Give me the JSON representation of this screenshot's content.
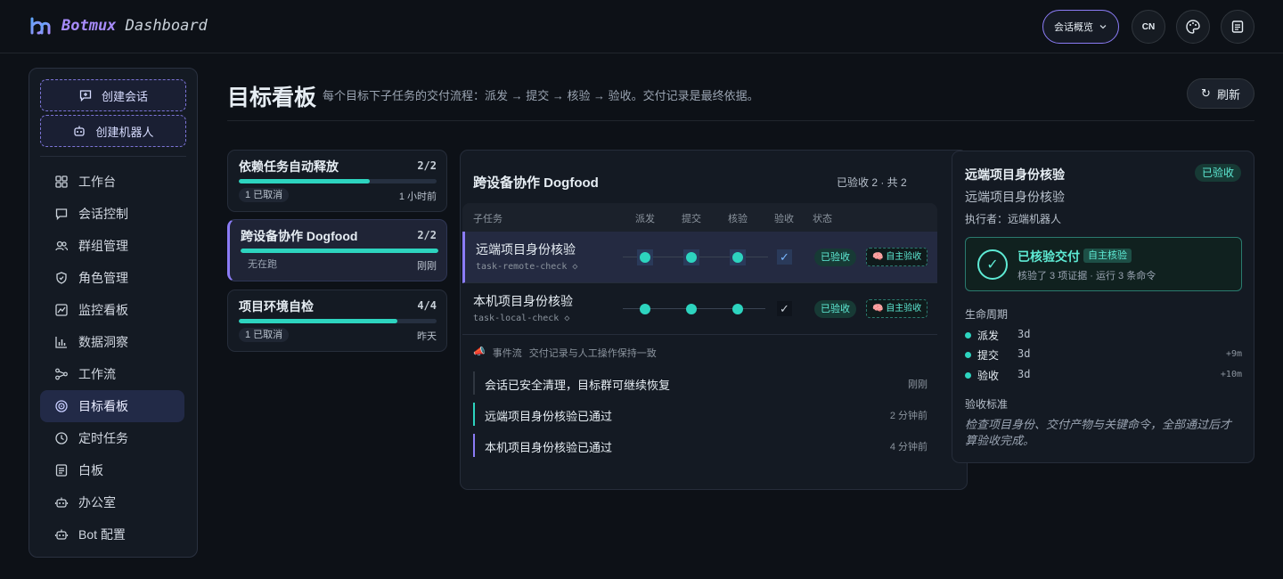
{
  "header": {
    "brand_a": "Botmux",
    "brand_b": "Dashboard",
    "view_select": "会话概览",
    "lang_button": "CN"
  },
  "sidebar": {
    "create_session": "创建会话",
    "create_bot": "创建机器人",
    "items": [
      {
        "label": "工作台",
        "icon": "grid-icon"
      },
      {
        "label": "会话控制",
        "icon": "chat-icon"
      },
      {
        "label": "群组管理",
        "icon": "users-icon"
      },
      {
        "label": "角色管理",
        "icon": "shield-icon"
      },
      {
        "label": "监控看板",
        "icon": "monitor-icon"
      },
      {
        "label": "数据洞察",
        "icon": "bar-chart-icon"
      },
      {
        "label": "工作流",
        "icon": "workflow-icon"
      },
      {
        "label": "目标看板",
        "icon": "target-icon",
        "active": true
      },
      {
        "label": "定时任务",
        "icon": "clock-icon"
      },
      {
        "label": "白板",
        "icon": "document-icon"
      },
      {
        "label": "办公室",
        "icon": "robot-icon"
      },
      {
        "label": "Bot 配置",
        "icon": "robot-icon"
      }
    ]
  },
  "main": {
    "title": "目标看板",
    "description": "每个目标下子任务的交付流程：派发 → 提交 → 核验 → 验收。交付记录是最终依据。",
    "refresh": "刷新"
  },
  "goals": [
    {
      "title": "依赖任务自动释放",
      "count": "2/2",
      "progress": 0.66,
      "left": "1 已取消",
      "right": "1 小时前"
    },
    {
      "title": "跨设备协作 Dogfood",
      "count": "2/2",
      "progress": 1.0,
      "left": "无在跑",
      "right": "刚刚",
      "active": true
    },
    {
      "title": "项目环境自检",
      "count": "4/4",
      "progress": 0.8,
      "left": "1 已取消",
      "right": "昨天"
    }
  ],
  "detail": {
    "title": "跨设备协作 Dogfood",
    "summary": "已验收 2 · 共 2",
    "columns": {
      "task": "子任务",
      "dispatch": "派发",
      "submit": "提交",
      "verify": "核验",
      "accept": "验收",
      "status": "状态"
    },
    "rows": [
      {
        "title": "远端项目身份核验",
        "id": "task-remote-check ◇",
        "status": "已验收",
        "auto": "🧠 自主验收"
      },
      {
        "title": "本机项目身份核验",
        "id": "task-local-check ◇",
        "status": "已验收",
        "auto": "🧠 自主验收"
      }
    ],
    "events_icon": "📣",
    "events_label": "事件流",
    "events_note": "交付记录与人工操作保持一致",
    "events": [
      {
        "text": "会话已安全清理，目标群可继续恢复",
        "time": "刚刚"
      },
      {
        "text": "远端项目身份核验已通过",
        "time": "2 分钟前"
      },
      {
        "text": "本机项目身份核验已通过",
        "time": "4 分钟前"
      }
    ]
  },
  "task_panel": {
    "title": "远端项目身份核验",
    "badge": "已验收",
    "subtitle": "远端项目身份核验",
    "executor": "执行者：远端机器人",
    "verified_title": "已核验交付",
    "verified_tag": "自主核验",
    "verified_note": "核验了 3 项证据 · 运行 3 条命令",
    "lifecycle_label": "生命周期",
    "lifecycle": [
      {
        "name": "派发",
        "value": "3d",
        "delta": ""
      },
      {
        "name": "提交",
        "value": "3d",
        "delta": "+9m"
      },
      {
        "name": "验收",
        "value": "3d",
        "delta": "+10m"
      }
    ],
    "criteria_label": "验收标准",
    "criteria": "检查项目身份、交付产物与关键命令，全部通过后才算验收完成。"
  },
  "colors": {
    "accent": "#8b7cf6",
    "success": "#2dd4bf",
    "background": "#0d1117"
  }
}
